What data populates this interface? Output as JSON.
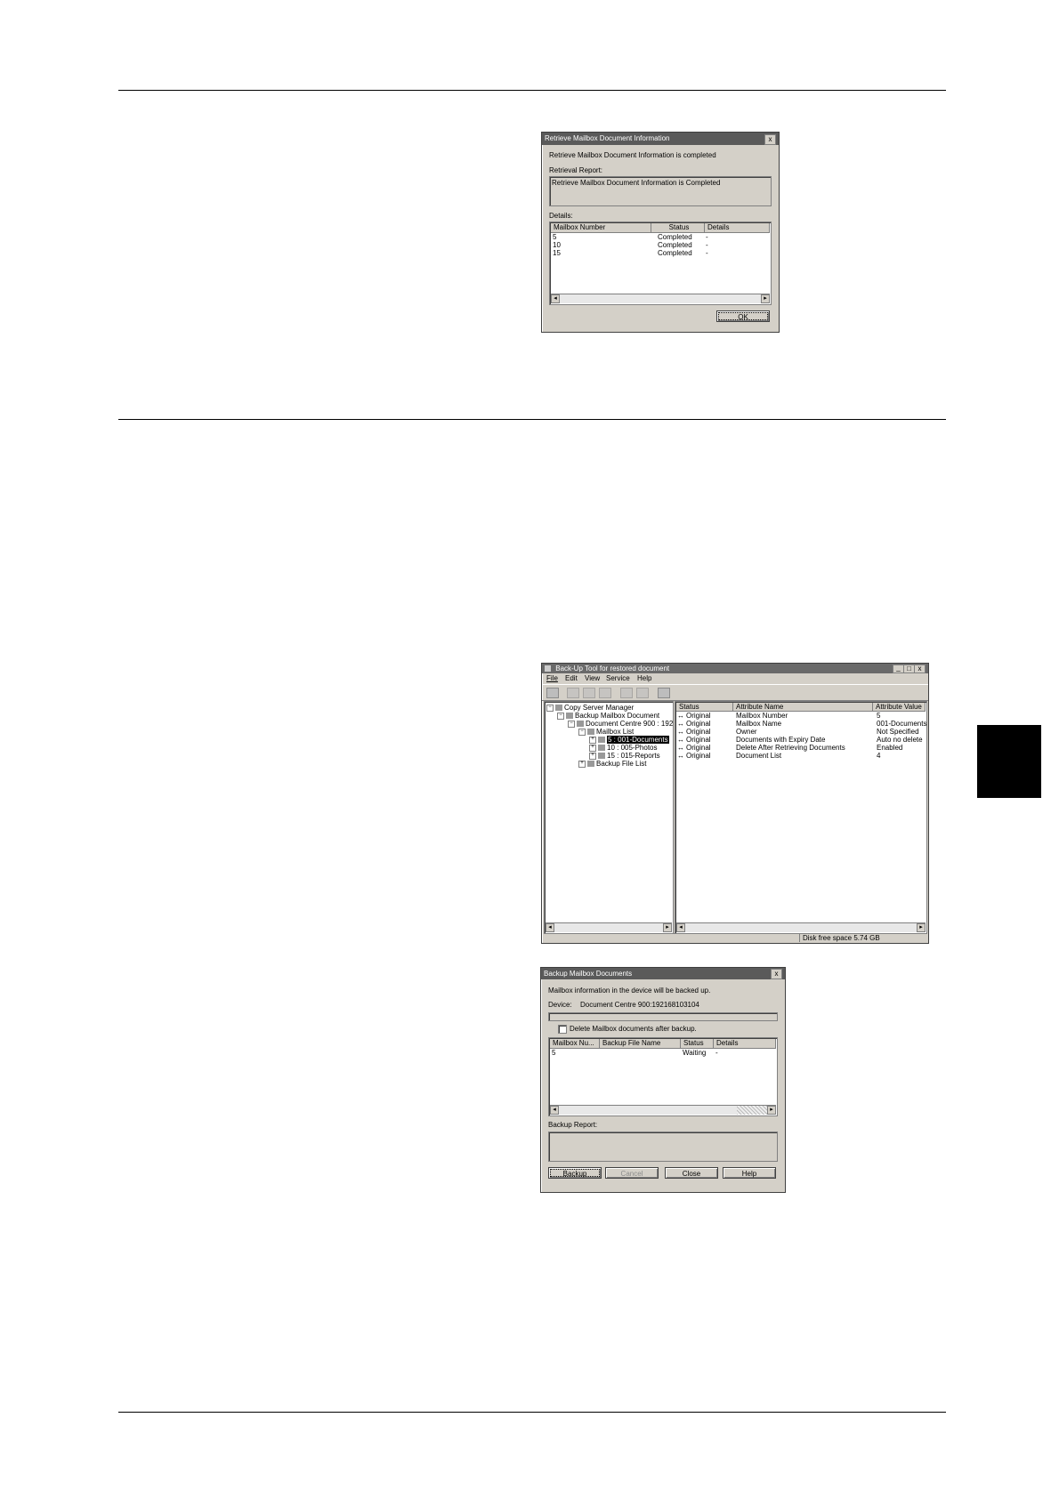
{
  "dialog1": {
    "title": "Retrieve Mailbox Document Information",
    "close": "x",
    "message": "Retrieve Mailbox Document Information is completed",
    "report_label": "Retrieval Report:",
    "report_text": "Retrieve Mailbox Document Information is Completed",
    "details_label": "Details:",
    "columns": [
      "Mailbox Number",
      "Status",
      "Details"
    ],
    "rows": [
      [
        "5",
        "Completed",
        "-"
      ],
      [
        "10",
        "Completed",
        "-"
      ],
      [
        "15",
        "Completed",
        "-"
      ]
    ],
    "ok": "OK"
  },
  "main_window": {
    "title": "Back-Up Tool for restored document",
    "menu": [
      "File",
      "Edit",
      "View",
      "Service",
      "Help"
    ],
    "tree": {
      "root": "Copy Server Manager",
      "backup_mailbox": "Backup Mailbox Document",
      "device": "Document Centre 900 : 192",
      "mailbox_list": "Mailbox List",
      "items": [
        "5 : 001-Documents",
        "10 : 005-Photos",
        "15 : 015-Reports"
      ],
      "backup_file_list": "Backup File List"
    },
    "columns": [
      "Status",
      "Attribute Name",
      "Attribute Value"
    ],
    "rows": [
      [
        "Original",
        "Mailbox Number",
        "5"
      ],
      [
        "Original",
        "Mailbox Name",
        "001-Documents"
      ],
      [
        "Original",
        "Owner",
        "Not Specified"
      ],
      [
        "Original",
        "Documents with Expiry Date",
        "Auto no delete"
      ],
      [
        "Original",
        "Delete After Retrieving Documents",
        "Enabled"
      ],
      [
        "Original",
        "Document List",
        "4"
      ]
    ],
    "status_bar": "Disk free space 5.74 GB"
  },
  "dialog2": {
    "title": "Backup Mailbox Documents",
    "close": "x",
    "message": "Mailbox information in the device will be backed up.",
    "device_label": "Device:",
    "device_value": "Document Centre 900:192168103104",
    "checkbox_label": "Delete Mailbox documents after backup.",
    "columns": [
      "Mailbox Nu...",
      "Backup File Name",
      "Status",
      "Details"
    ],
    "rows": [
      [
        "5",
        "",
        "Waiting",
        "-"
      ]
    ],
    "report_label": "Backup Report:",
    "buttons": {
      "backup": "Backup",
      "cancel": "Cancel",
      "close": "Close",
      "help": "Help"
    }
  }
}
